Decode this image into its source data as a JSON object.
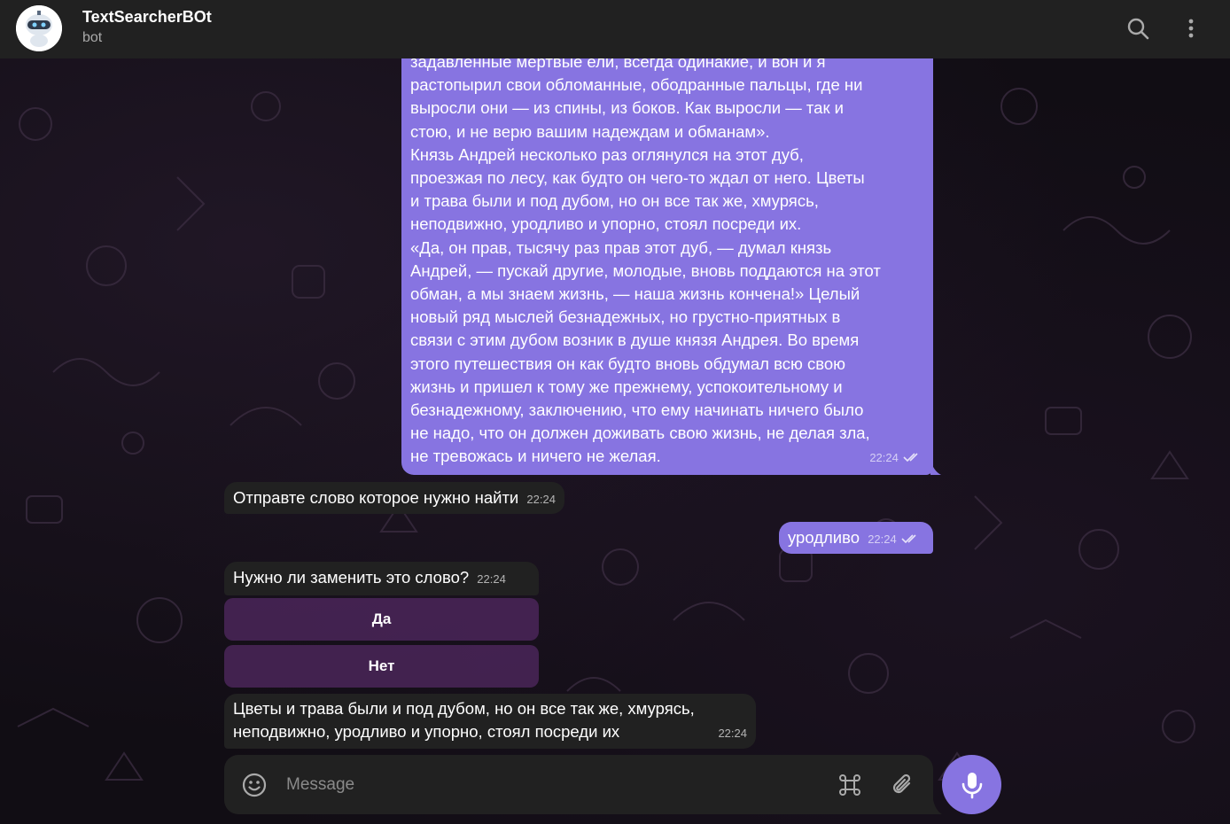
{
  "header": {
    "title": "TextSearcherBOt",
    "subtitle": "bot"
  },
  "messages": {
    "long_text": {
      "lines": [
        "задавленные мертвые ели, всегда одинакие, и вон и я",
        "растопырил свои обломанные, ободранные пальцы, где ни",
        "выросли они — из спины, из боков. Как выросли — так и",
        "стою, и не верю вашим надеждам и обманам».",
        "Князь Андрей несколько раз оглянулся на этот дуб,",
        "проезжая по лесу, как будто он чего-то ждал от него. Цветы",
        "и трава были и под дубом, но он все так же, хмурясь,",
        "неподвижно, уродливо и упорно, стоял посреди их.",
        "«Да, он прав, тысячу раз прав этот дуб, — думал князь",
        "Андрей, — пускай другие, молодые, вновь поддаются на этот",
        "обман, а мы знаем жизнь, — наша жизнь кончена!» Целый",
        "новый ряд мыслей безнадежных, но грустно-приятных в",
        "связи с этим дубом возник в душе князя Андрея. Во время",
        "этого путешествия он как будто вновь обдумал всю свою",
        "жизнь и пришел к тому же прежнему, успокоительному и",
        "безнадежному, заключению, что ему начинать ничего было",
        "не надо, что он должен доживать свою жизнь, не делая зла,",
        "не тревожась и ничего не желая."
      ],
      "time": "22:24"
    },
    "prompt_word": {
      "text": "Отправте слово которое нужно найти",
      "time": "22:24"
    },
    "user_word": {
      "text": "уродливо",
      "time": "22:24"
    },
    "replace_question": {
      "text": "Нужно ли заменить это слово?",
      "time": "22:24"
    },
    "keyboard": {
      "yes": "Да",
      "no": "Нет"
    },
    "result": {
      "line1": "Цветы и трава были и под дубом, но он все так же, хмурясь,",
      "line2": "неподвижно, уродливо и упорно, стоял посреди их",
      "time": "22:24"
    }
  },
  "composer": {
    "placeholder": "Message"
  },
  "colors": {
    "accent": "#8774e1",
    "bubble_in": "#212121",
    "header": "#212121"
  }
}
